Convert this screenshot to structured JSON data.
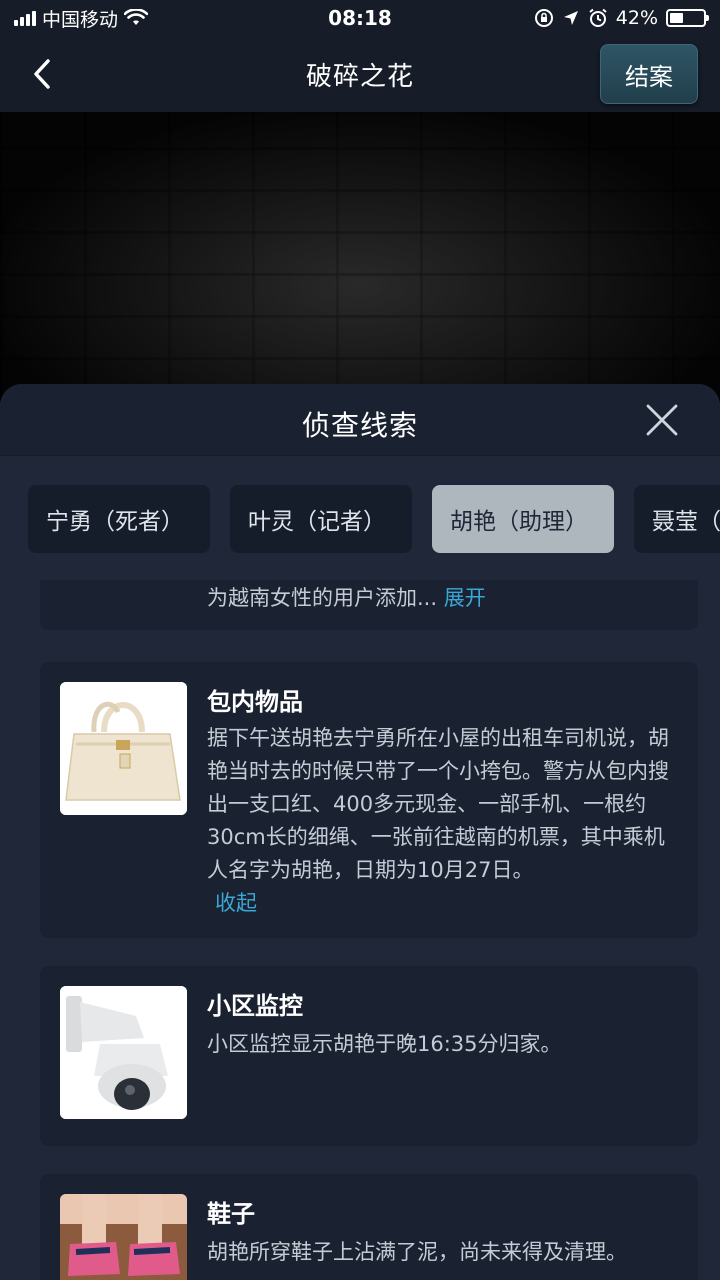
{
  "status_bar": {
    "carrier": "中国移动",
    "time": "08:18",
    "battery_text": "42%",
    "battery_level": 0.42
  },
  "nav": {
    "title": "破碎之花",
    "close_case_label": "结案",
    "back_icon": "chevron-left-icon"
  },
  "sheet": {
    "title": "侦查线索",
    "close_icon": "close-icon"
  },
  "tabs": [
    {
      "label": "宁勇（死者）",
      "active": false
    },
    {
      "label": "叶灵（记者）",
      "active": false
    },
    {
      "label": "胡艳（助理）",
      "active": true
    },
    {
      "label": "聂莹（",
      "active": false
    }
  ],
  "clues": [
    {
      "title": "",
      "desc": "为越南女性的用户添加...",
      "toggle_label": "展开"
    },
    {
      "title": "包内物品",
      "desc": "据下午送胡艳去宁勇所在小屋的出租车司机说，胡艳当时去的时候只带了一个小挎包。警方从包内搜出一支口红、400多元现金、一部手机、一根约30cm长的细绳、一张前往越南的机票，其中乘机人名字为胡艳，日期为10月27日。",
      "toggle_label": "收起",
      "image": "handbag"
    },
    {
      "title": "小区监控",
      "desc": "小区监控显示胡艳于晚16:35分归家。",
      "image": "security-camera"
    },
    {
      "title": "鞋子",
      "desc": "胡艳所穿鞋子上沾满了泥，尚未来得及清理。",
      "image": "sneakers"
    }
  ],
  "colors": {
    "accent_link": "#3aa8d6",
    "active_tab": "#aeb7be",
    "sheet_bg": "#1f2738",
    "card_bg": "#1a2130"
  }
}
